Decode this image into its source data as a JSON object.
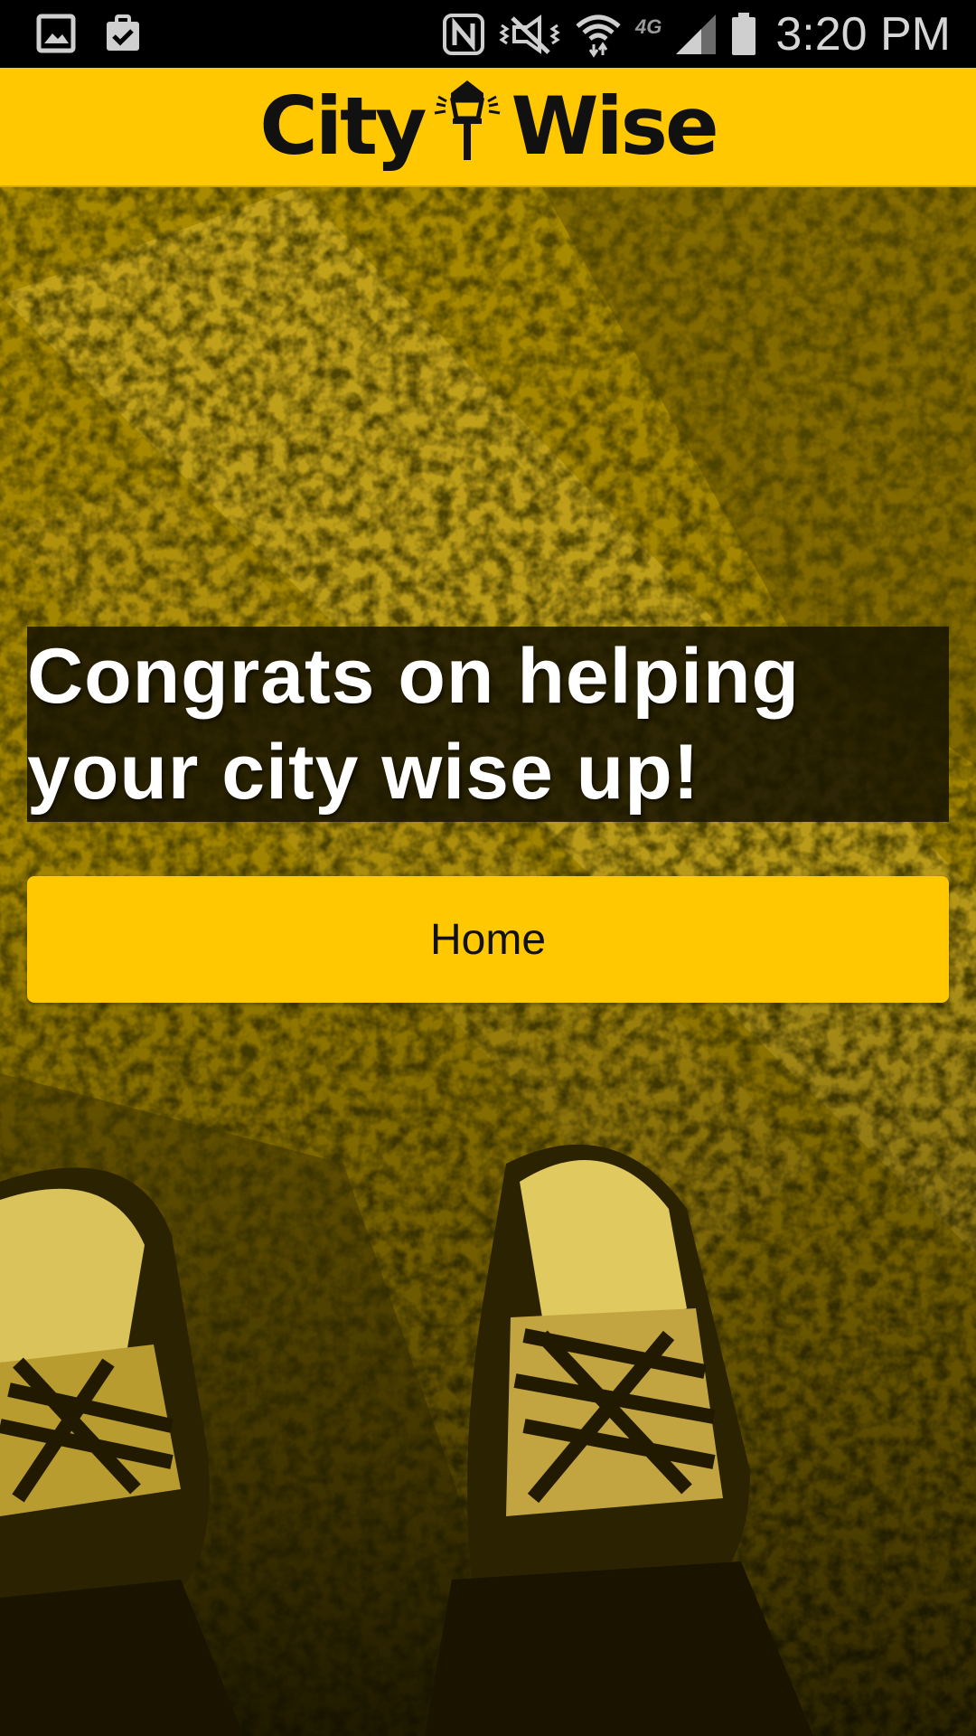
{
  "status_bar": {
    "time": "3:20 PM",
    "network": "4G",
    "left_icons": [
      "gallery-icon",
      "clipboard-check-icon"
    ],
    "right_icons": [
      "nfc-icon",
      "vibrate-icon",
      "wifi-icon",
      "signal-icon",
      "battery-icon"
    ]
  },
  "header": {
    "logo_left": "City",
    "logo_right": "Wise",
    "logo_icon": "street-lamp-icon",
    "background_color": "#ffc800"
  },
  "main": {
    "message": "Congrats on helping your city wise up!",
    "home_button_label": "Home",
    "background_image": "sneakers-on-asphalt-photo"
  },
  "colors": {
    "accent": "#ffc800",
    "text_dark": "#111111",
    "text_light": "#ffffff"
  }
}
